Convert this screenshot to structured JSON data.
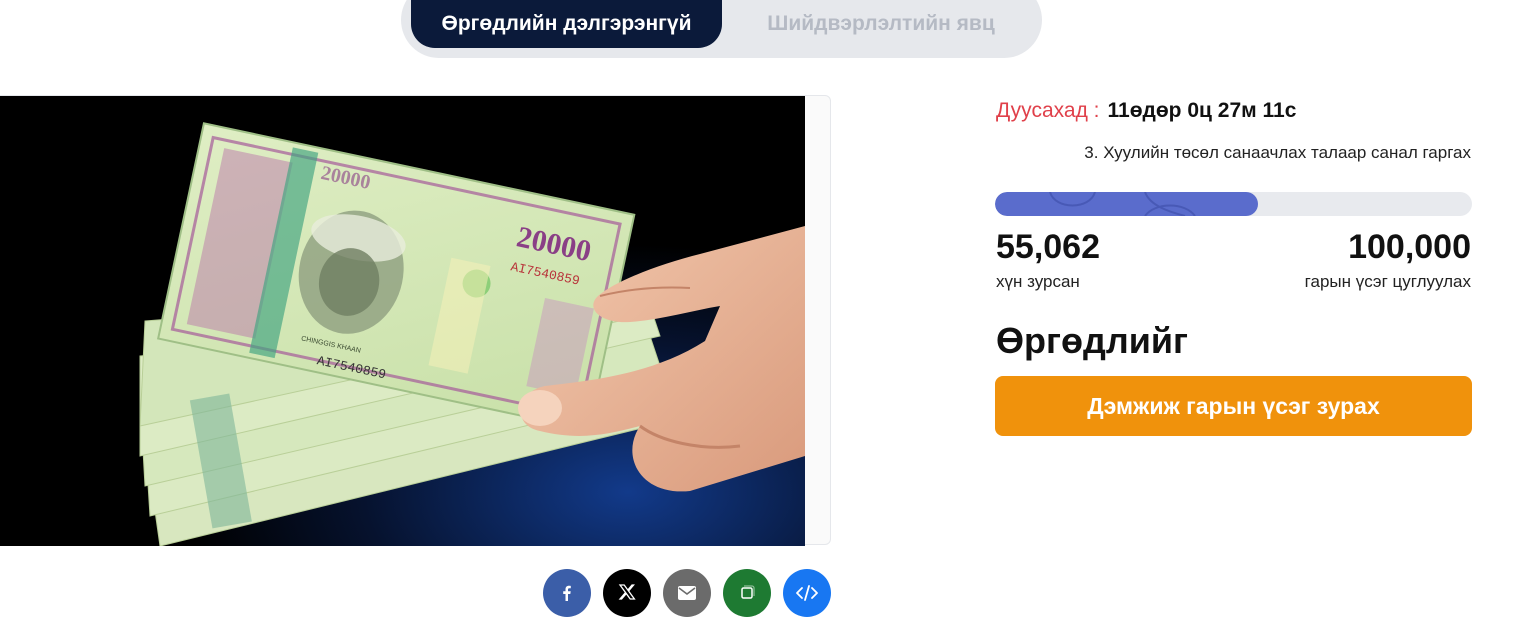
{
  "tabs": [
    {
      "label": "Өргөдлийн дэлгэрэнгүй",
      "active": true
    },
    {
      "label": "Шийдвэрлэлтийн явц",
      "active": false
    }
  ],
  "image": {
    "banknote_text": {
      "denomination": "20000",
      "serial": "AI7540859",
      "portrait_caption": "CHINGGIS KHAAN"
    }
  },
  "petition": {
    "deadline_label": "Дуусахад :",
    "deadline_value": "11өдөр 0ц 27м 11с",
    "title": "3. Хуулийн төсөл санаачлах талаар санал гаргах",
    "progress_fraction": 0.5506,
    "signed_count": "55,062",
    "signed_label": "хүн зурсан",
    "goal_count": "100,000",
    "goal_label": "гарын үсэг цуглуулах",
    "cta_heading": "Өргөдлийг",
    "cta_button": "Дэмжиж гарын үсэг зурах"
  },
  "share": [
    {
      "icon": "facebook-icon",
      "color": "#3b5ea8"
    },
    {
      "icon": "x-icon",
      "color": "#000000"
    },
    {
      "icon": "email-icon",
      "color": "#6b6b6b"
    },
    {
      "icon": "copy-icon",
      "color": "#1e7a32"
    },
    {
      "icon": "embed-icon",
      "color": "#1877f2"
    }
  ],
  "colors": {
    "tab_active_bg": "#0b1a3a",
    "deadline_label": "#e0404a",
    "progress": "#5a6ccc",
    "cta": "#f0920c"
  }
}
